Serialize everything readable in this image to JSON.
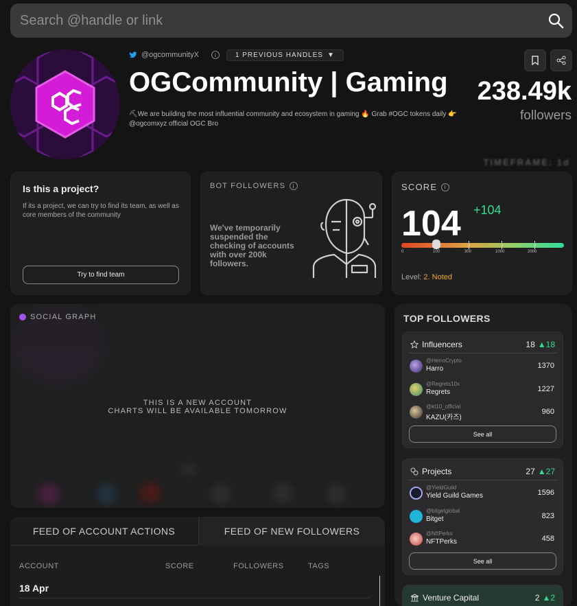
{
  "search": {
    "placeholder": "Search @handle or link"
  },
  "profile": {
    "handle": "@ogcommunityX",
    "prev_handles": "1 PREVIOUS HANDLES",
    "title": "OGCommunity | Gaming",
    "bio": "⛏We are building the most influential community and ecosystem in gaming 🔥 Grab #OGC tokens daily 👉 @ogcomxyz official OGC Bro",
    "followers_count": "238.49k",
    "followers_label": "followers",
    "timeframe": "TIMEFRAME: 1d"
  },
  "project_card": {
    "title": "Is this a project?",
    "text": "If its a project, we can try to find its team, as well as core members of the community",
    "button": "Try to find team"
  },
  "bot_card": {
    "caption": "BOT FOLLOWERS",
    "text": "We've temporarily suspended the checking of accounts with over 200k followers."
  },
  "score_card": {
    "caption": "SCORE",
    "value": "104",
    "delta": "+104",
    "ticks": [
      "0",
      "100",
      "300",
      "1000",
      "2000"
    ],
    "level_label": "Level:",
    "level_value": "2. Noted"
  },
  "social_graph": {
    "caption": "SOCIAL GRAPH",
    "line1": "THIS IS A NEW ACCOUNT",
    "line2": "CHARTS WILL BE AVAILABLE TOMORROW"
  },
  "feed": {
    "tab1": "FEED OF ACCOUNT ACTIONS",
    "tab2": "FEED OF NEW FOLLOWERS",
    "columns": [
      "ACCOUNT",
      "SCORE",
      "FOLLOWERS",
      "TAGS"
    ],
    "date": "18 Apr"
  },
  "top_followers": {
    "title": "TOP FOLLOWERS",
    "groups": [
      {
        "name": "Influencers",
        "count": "18",
        "up": "▲18",
        "rows": [
          {
            "handle": "@HerroCrypto",
            "name": "Harro",
            "value": "1370"
          },
          {
            "handle": "@Regrets10x",
            "name": "Regrets",
            "value": "1227"
          },
          {
            "handle": "@kt10_official",
            "name": "KAZU(카즈)",
            "value": "960"
          }
        ],
        "see_all": "See all"
      },
      {
        "name": "Projects",
        "count": "27",
        "up": "▲27",
        "rows": [
          {
            "handle": "@YieldGuild",
            "name": "Yield Guild Games",
            "value": "1596"
          },
          {
            "handle": "@bitgetglobal",
            "name": "Bitget",
            "value": "823"
          },
          {
            "handle": "@NftPerks",
            "name": "NFTPerks",
            "value": "458"
          }
        ],
        "see_all": "See all"
      },
      {
        "name": "Venture Capital",
        "count": "2",
        "up": "▲2"
      }
    ]
  },
  "colors": {
    "accent_green": "#2ddf8e",
    "level_orange": "#f0a92e",
    "graph_purple": "#a454f0",
    "avatar_magenta": "#d41cd8"
  }
}
